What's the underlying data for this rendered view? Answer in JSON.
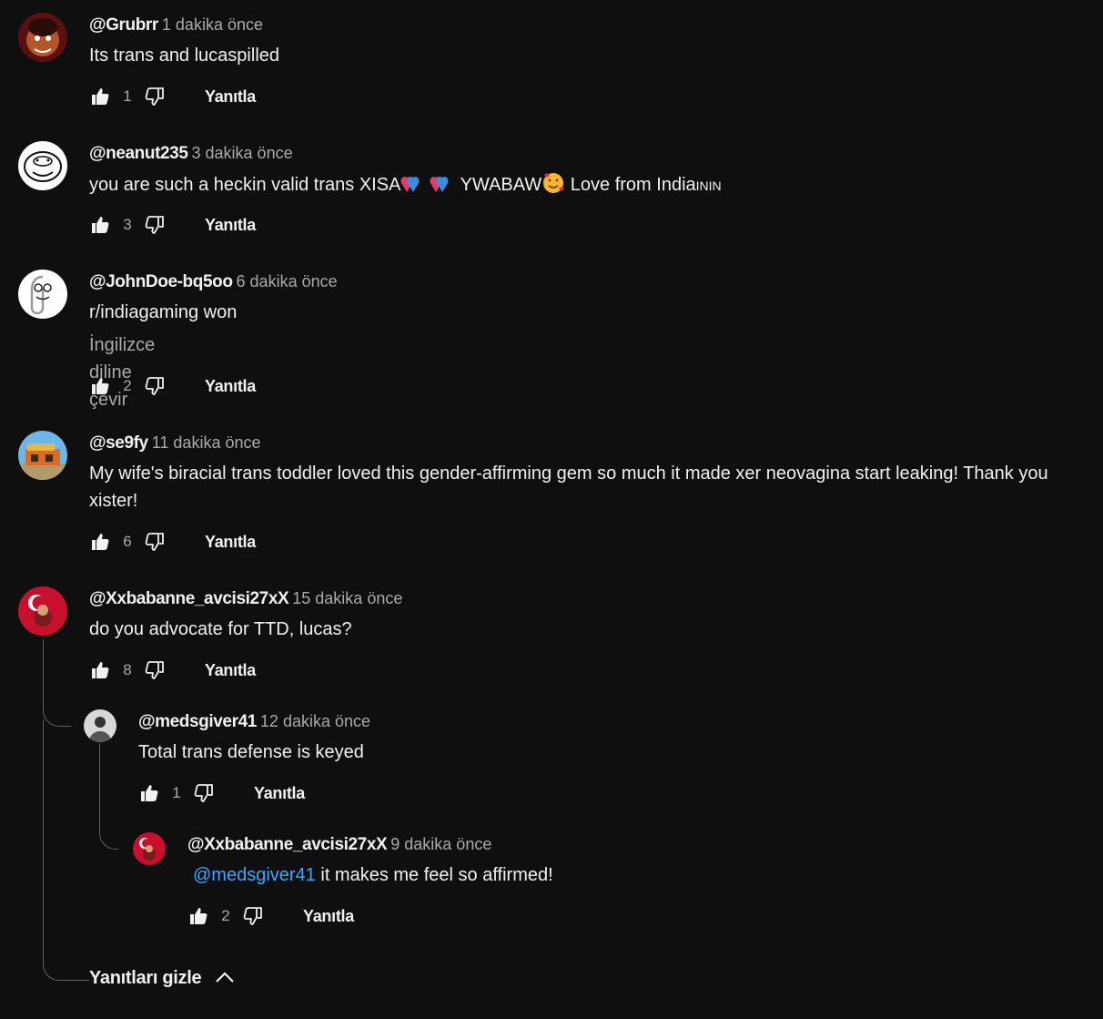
{
  "comments": [
    {
      "author": "@Grubrr",
      "time": "1 dakika önce",
      "text": "Its trans and lucaspilled",
      "likes": "1",
      "reply": "Yanıtla"
    },
    {
      "author": "@neanut235",
      "time": "3 dakika önce",
      "text_before": "you are such a heckin valid trans XISA",
      "text_middle": " YWABAW",
      "text_after": " Love from India",
      "text_flag": "ININ",
      "likes": "3",
      "reply": "Yanıtla"
    },
    {
      "author": "@JohnDoe-bq5oo",
      "time": "6 dakika önce",
      "text": "r/indiagaming won",
      "translate": "İngilizce diline çevir",
      "likes": "2",
      "reply": "Yanıtla"
    },
    {
      "author": "@se9fy",
      "time": "11 dakika önce",
      "text": "My wife's biracial trans toddler loved this gender-affirming gem so much it made xer neovagina start leaking! Thank you xister!",
      "likes": "6",
      "reply": "Yanıtla"
    },
    {
      "author": "@Xxbabanne_avcisi27xX",
      "time": "15 dakika önce",
      "text": "do you advocate for TTD, lucas?",
      "likes": "8",
      "reply": "Yanıtla"
    }
  ],
  "replies": [
    {
      "author": "@medsgiver41",
      "time": "12 dakika önce",
      "text": "Total trans defense is keyed",
      "likes": "1",
      "reply": "Yanıtla"
    },
    {
      "author": "@Xxbabanne_avcisi27xX",
      "time": "9 dakika önce",
      "mention": "@medsgiver41",
      "text": " it makes me feel so affirmed!",
      "likes": "2",
      "reply": "Yanıtla"
    }
  ],
  "hide_replies_label": "Yanıtları gizle",
  "icons": {
    "like": "thumbs-up-icon",
    "dislike": "thumbs-down-icon",
    "collapse": "chevron-up-icon"
  },
  "colors": {
    "background": "#0f0f0f",
    "text": "#f1f1f1",
    "secondary": "#aaaaaa",
    "mention": "#3ea6ff",
    "thread_line": "#606060"
  }
}
